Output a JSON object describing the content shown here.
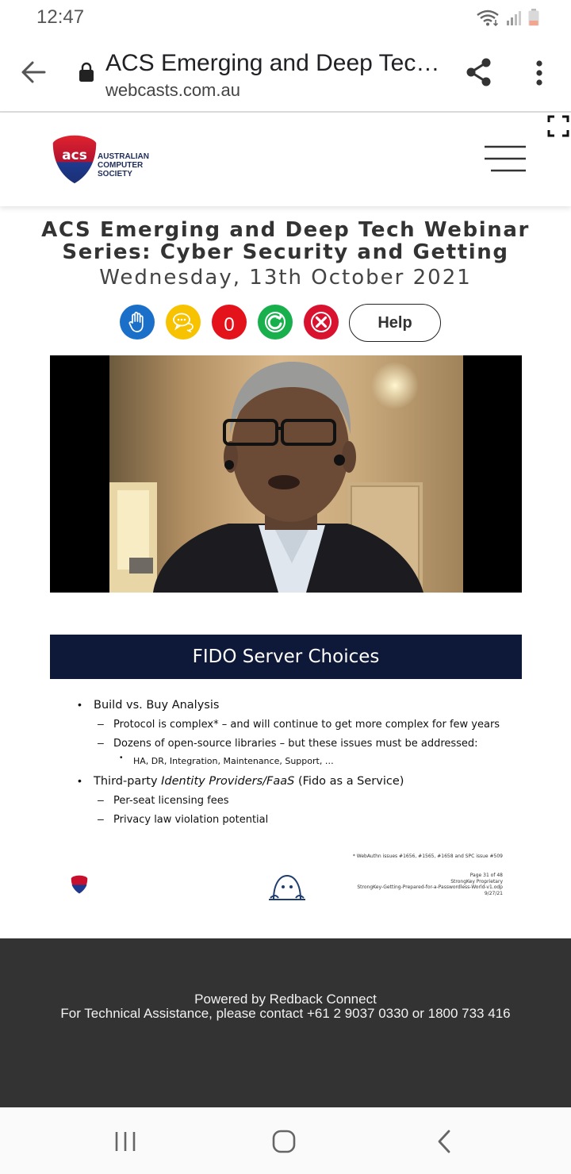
{
  "status_bar": {
    "time": "12:47"
  },
  "browser": {
    "tab_title": "ACS Emerging and Deep Tec…",
    "url": "webcasts.com.au"
  },
  "site_header": {
    "logo_text": "acs",
    "org_name_lines": [
      "AUSTRALIAN",
      "COMPUTER",
      "SOCIETY"
    ]
  },
  "webinar": {
    "title_line1": "ACS Emerging and Deep Tech Webinar",
    "title_line2": "Series: Cyber Security and Getting",
    "date": "Wednesday, 13th October 2021",
    "question_count": "0",
    "help_label": "Help"
  },
  "slide": {
    "title": "FIDO Server Choices",
    "bullets": [
      {
        "text": "Build vs. Buy Analysis",
        "subs": [
          "Protocol is complex* – and will continue to get more complex for few years",
          "Dozens of open-source libraries – but these issues must be addressed:"
        ],
        "subsub": "HA, DR, Integration, Maintenance, Support, …"
      },
      {
        "text_pre": "Third-party ",
        "text_italic": "Identity Providers/FaaS",
        "text_post": " (Fido as a Service)",
        "subs": [
          "Per-seat licensing fees",
          "Privacy law violation potential"
        ]
      }
    ],
    "footnote": "* WebAuthn issues #1656, #1565, #1658 and SPC issue #509",
    "footer_lines": [
      "Page 31 of 48",
      "StrongKey Proprietary",
      "StrongKey-Getting-Prepared-for-a-Passwordless-World-v1.odp",
      "9/27/21"
    ]
  },
  "footer": {
    "powered_by": "Powered by Redback Connect",
    "contact": "For Technical Assistance, please contact +61 2 9037 0330 or 1800 733 416"
  },
  "colors": {
    "raise_hand": "#1a6fc8",
    "chat": "#f7c200",
    "questions": "#e3121b",
    "refresh": "#17b04c",
    "close": "#d9122f",
    "slide_header": "#0e1838",
    "footer_bg": "#333333"
  }
}
